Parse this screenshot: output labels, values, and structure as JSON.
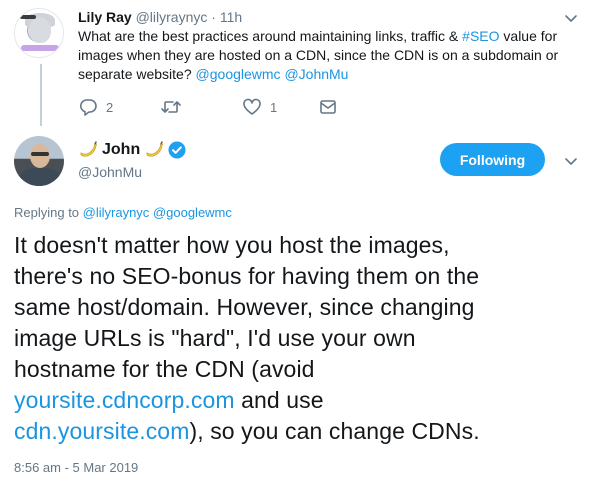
{
  "parent_tweet": {
    "name": "Lily Ray",
    "handle": "@lilyraynyc",
    "separator": " · ",
    "time": "11h",
    "text_before_hashtag": "What are the best practices around maintaining links, traffic & ",
    "hashtag": "#SEO",
    "text_after_hashtag": " value for",
    "line2": "images when they are hosted on a CDN, since the CDN is on a subdomain or",
    "line3_text": "separate website? ",
    "mention1": "@googlewmc",
    "mention2": "@JohnMu",
    "actions": {
      "reply_count": "2",
      "retweet_count": "",
      "like_count": "1"
    }
  },
  "main_tweet": {
    "name": "John",
    "handle": "@JohnMu",
    "follow_label": "Following",
    "replying_prefix": "Replying to ",
    "replying_mention1": "@lilyraynyc",
    "replying_mention2": "@googlewmc",
    "text": {
      "l1": "It doesn't matter how you host the images,",
      "l2": "there's no SEO-bonus for having them on the",
      "l3": "same host/domain. However, since changing",
      "l4": "image URLs is \"hard\", I'd use your own",
      "l5": "hostname for the CDN (avoid",
      "l6_link": "yoursite.cdncorp.com",
      "l6_rest": " and use",
      "l7_link": "cdn.yoursite.com",
      "l7_rest": "), so you can change CDNs."
    },
    "timestamp": "8:56 am - 5 Mar 2019"
  },
  "colors": {
    "link": "#1b95e0",
    "muted": "#657786",
    "follow_bg": "#1da1f2",
    "verified": "#1da1f2"
  },
  "icons": [
    "reply-icon",
    "retweet-icon",
    "like-icon",
    "dm-icon",
    "chevron-down-icon",
    "verified-badge-icon",
    "banana-emoji-icon"
  ]
}
